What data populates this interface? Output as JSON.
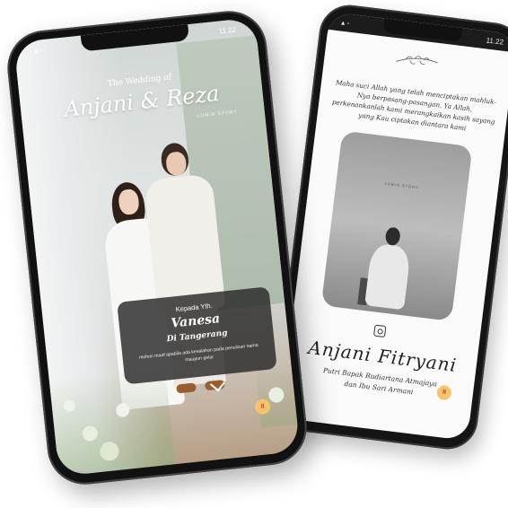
{
  "back_phone": {
    "status_time": "11.22",
    "verse": "Maha suci Allah yang telah menciptakan mahluk-Nya berpasang-pasangan. Ya Allah, perkenankanlah kami merangkaikan kasih sayang yang Kau ciptakan diantara kami",
    "photo_watermark": "LUMIN STORY",
    "name": "Anjani Fitryani",
    "parents_line1": "Putri Bapak Rudiartana Atmajaya",
    "parents_line2": "dan Ibu Sari Armani",
    "pause_glyph": "II",
    "icons": [
      "ornament-leaf-icon",
      "instagram-icon",
      "pause-icon"
    ]
  },
  "front_phone": {
    "status_time": "11.22",
    "subtitle": "The Wedding of",
    "title": "Anjani & Reza",
    "studio_watermark": "LUMIN STORY",
    "card": {
      "to_label": "Kepada Yth.",
      "guest_name": "Vanesa",
      "guest_city": "Di Tangerang",
      "note": "mohon maaf apabila ada kesalahan pada penulisan nama maupun gelar"
    },
    "pause_glyph": "II",
    "icons": [
      "chevron-down-icon",
      "pause-icon"
    ]
  },
  "colors": {
    "music_button": "#f4c46b",
    "card_bg": "#282828"
  }
}
